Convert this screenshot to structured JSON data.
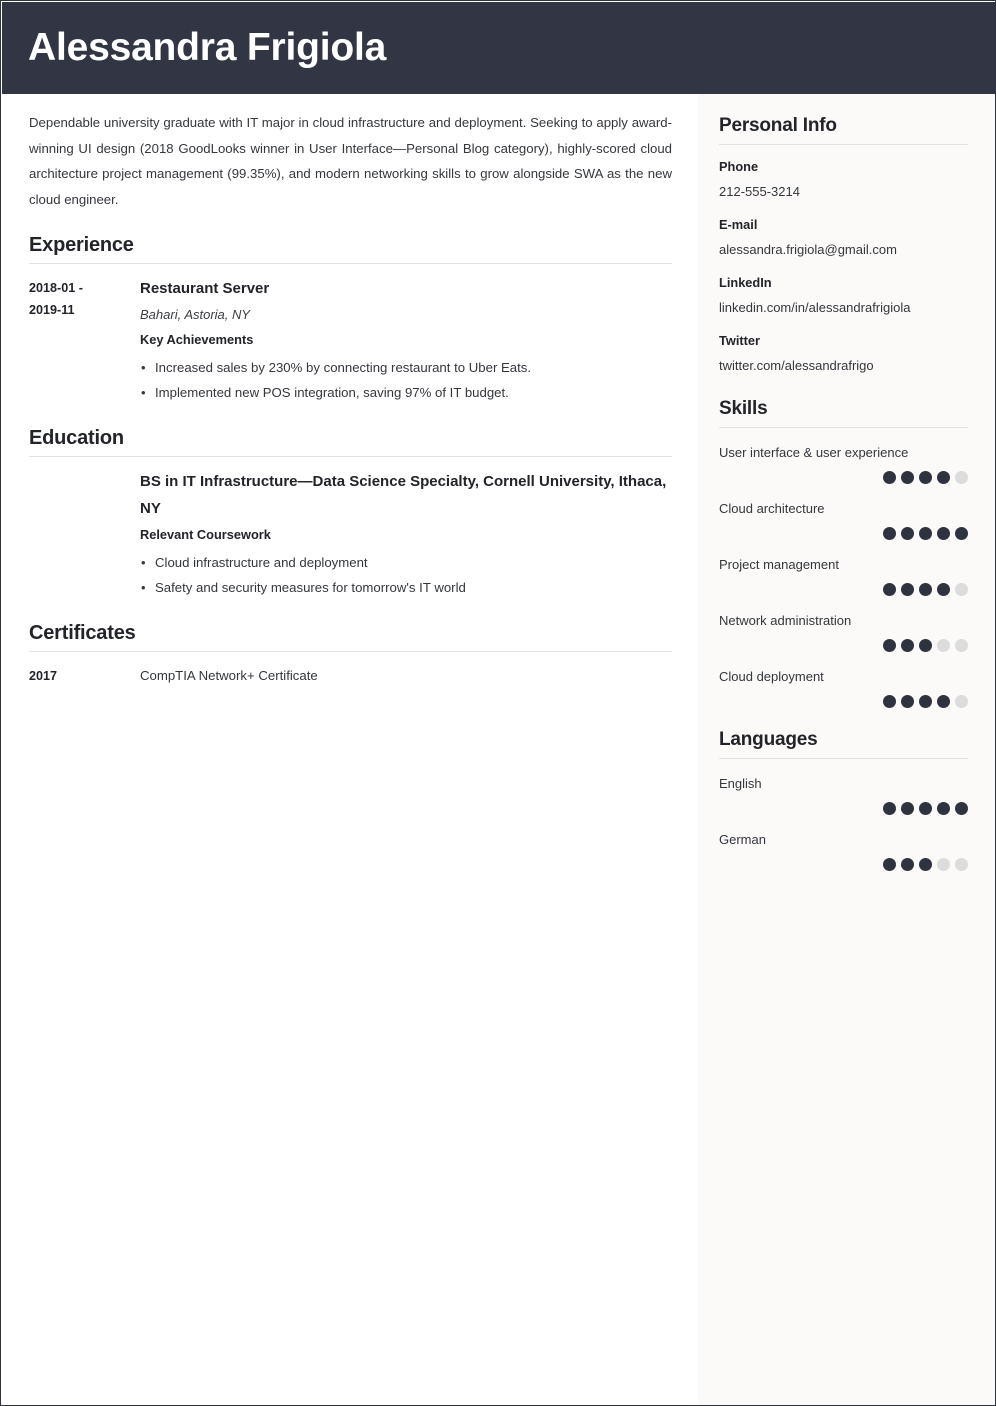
{
  "theme": {
    "header_bg": "#313544",
    "sidebar_bg": "#fbfaf8",
    "main_bg": "#ffffff",
    "text": "#34373d",
    "heading": "#22242a",
    "rule": "#e2e2e2",
    "dot_on": "#2f3340",
    "dot_off": "#dcdcdc"
  },
  "header": {
    "name": "Alessandra Frigiola"
  },
  "summary": {
    "text": "Dependable university graduate with IT major in cloud infrastructure and deployment. Seeking to apply award-winning UI design (2018 GoodLooks winner in User Interface—Personal Blog category), highly-scored cloud architecture project management (99.35%), and modern networking skills to grow alongside SWA as the new cloud engineer."
  },
  "experience": {
    "heading": "Experience",
    "entries": [
      {
        "date": "2018-01 -\n2019-11",
        "date_line1": "2018-01 -",
        "date_line2": "2019-11",
        "title": "Restaurant Server",
        "subtitle": "Bahari, Astoria, NY",
        "list_label": "Key Achievements",
        "bullets": [
          "Increased sales by 230% by connecting restaurant to Uber Eats.",
          "Implemented new POS integration, saving 97% of IT budget."
        ]
      }
    ]
  },
  "education": {
    "heading": "Education",
    "entries": [
      {
        "date": "",
        "title": "BS in IT Infrastructure—Data Science Specialty, Cornell University, Ithaca, NY",
        "list_label": "Relevant Coursework",
        "bullets": [
          "Cloud infrastructure and deployment",
          "Safety and security measures for tomorrow's IT world"
        ]
      }
    ]
  },
  "certificates": {
    "heading": "Certificates",
    "entries": [
      {
        "date": "2017",
        "text": "CompTIA Network+ Certificate"
      }
    ]
  },
  "personal_info": {
    "heading": "Personal Info",
    "items": [
      {
        "label": "Phone",
        "value": "212-555-3214"
      },
      {
        "label": "E-mail",
        "value": "alessandra.frigiola@gmail.com"
      },
      {
        "label": "LinkedIn",
        "value": "linkedin.com/in/alessandrafrigiola"
      },
      {
        "label": "Twitter",
        "value": "twitter.com/alessandrafrigo"
      }
    ]
  },
  "skills": {
    "heading": "Skills",
    "max_rating": 5,
    "items": [
      {
        "name": "User interface & user experience",
        "rating": 4
      },
      {
        "name": "Cloud architecture",
        "rating": 5
      },
      {
        "name": "Project management",
        "rating": 4
      },
      {
        "name": "Network administration",
        "rating": 3
      },
      {
        "name": "Cloud deployment",
        "rating": 4
      }
    ]
  },
  "languages": {
    "heading": "Languages",
    "max_rating": 5,
    "items": [
      {
        "name": "English",
        "rating": 5
      },
      {
        "name": "German",
        "rating": 3
      }
    ]
  }
}
